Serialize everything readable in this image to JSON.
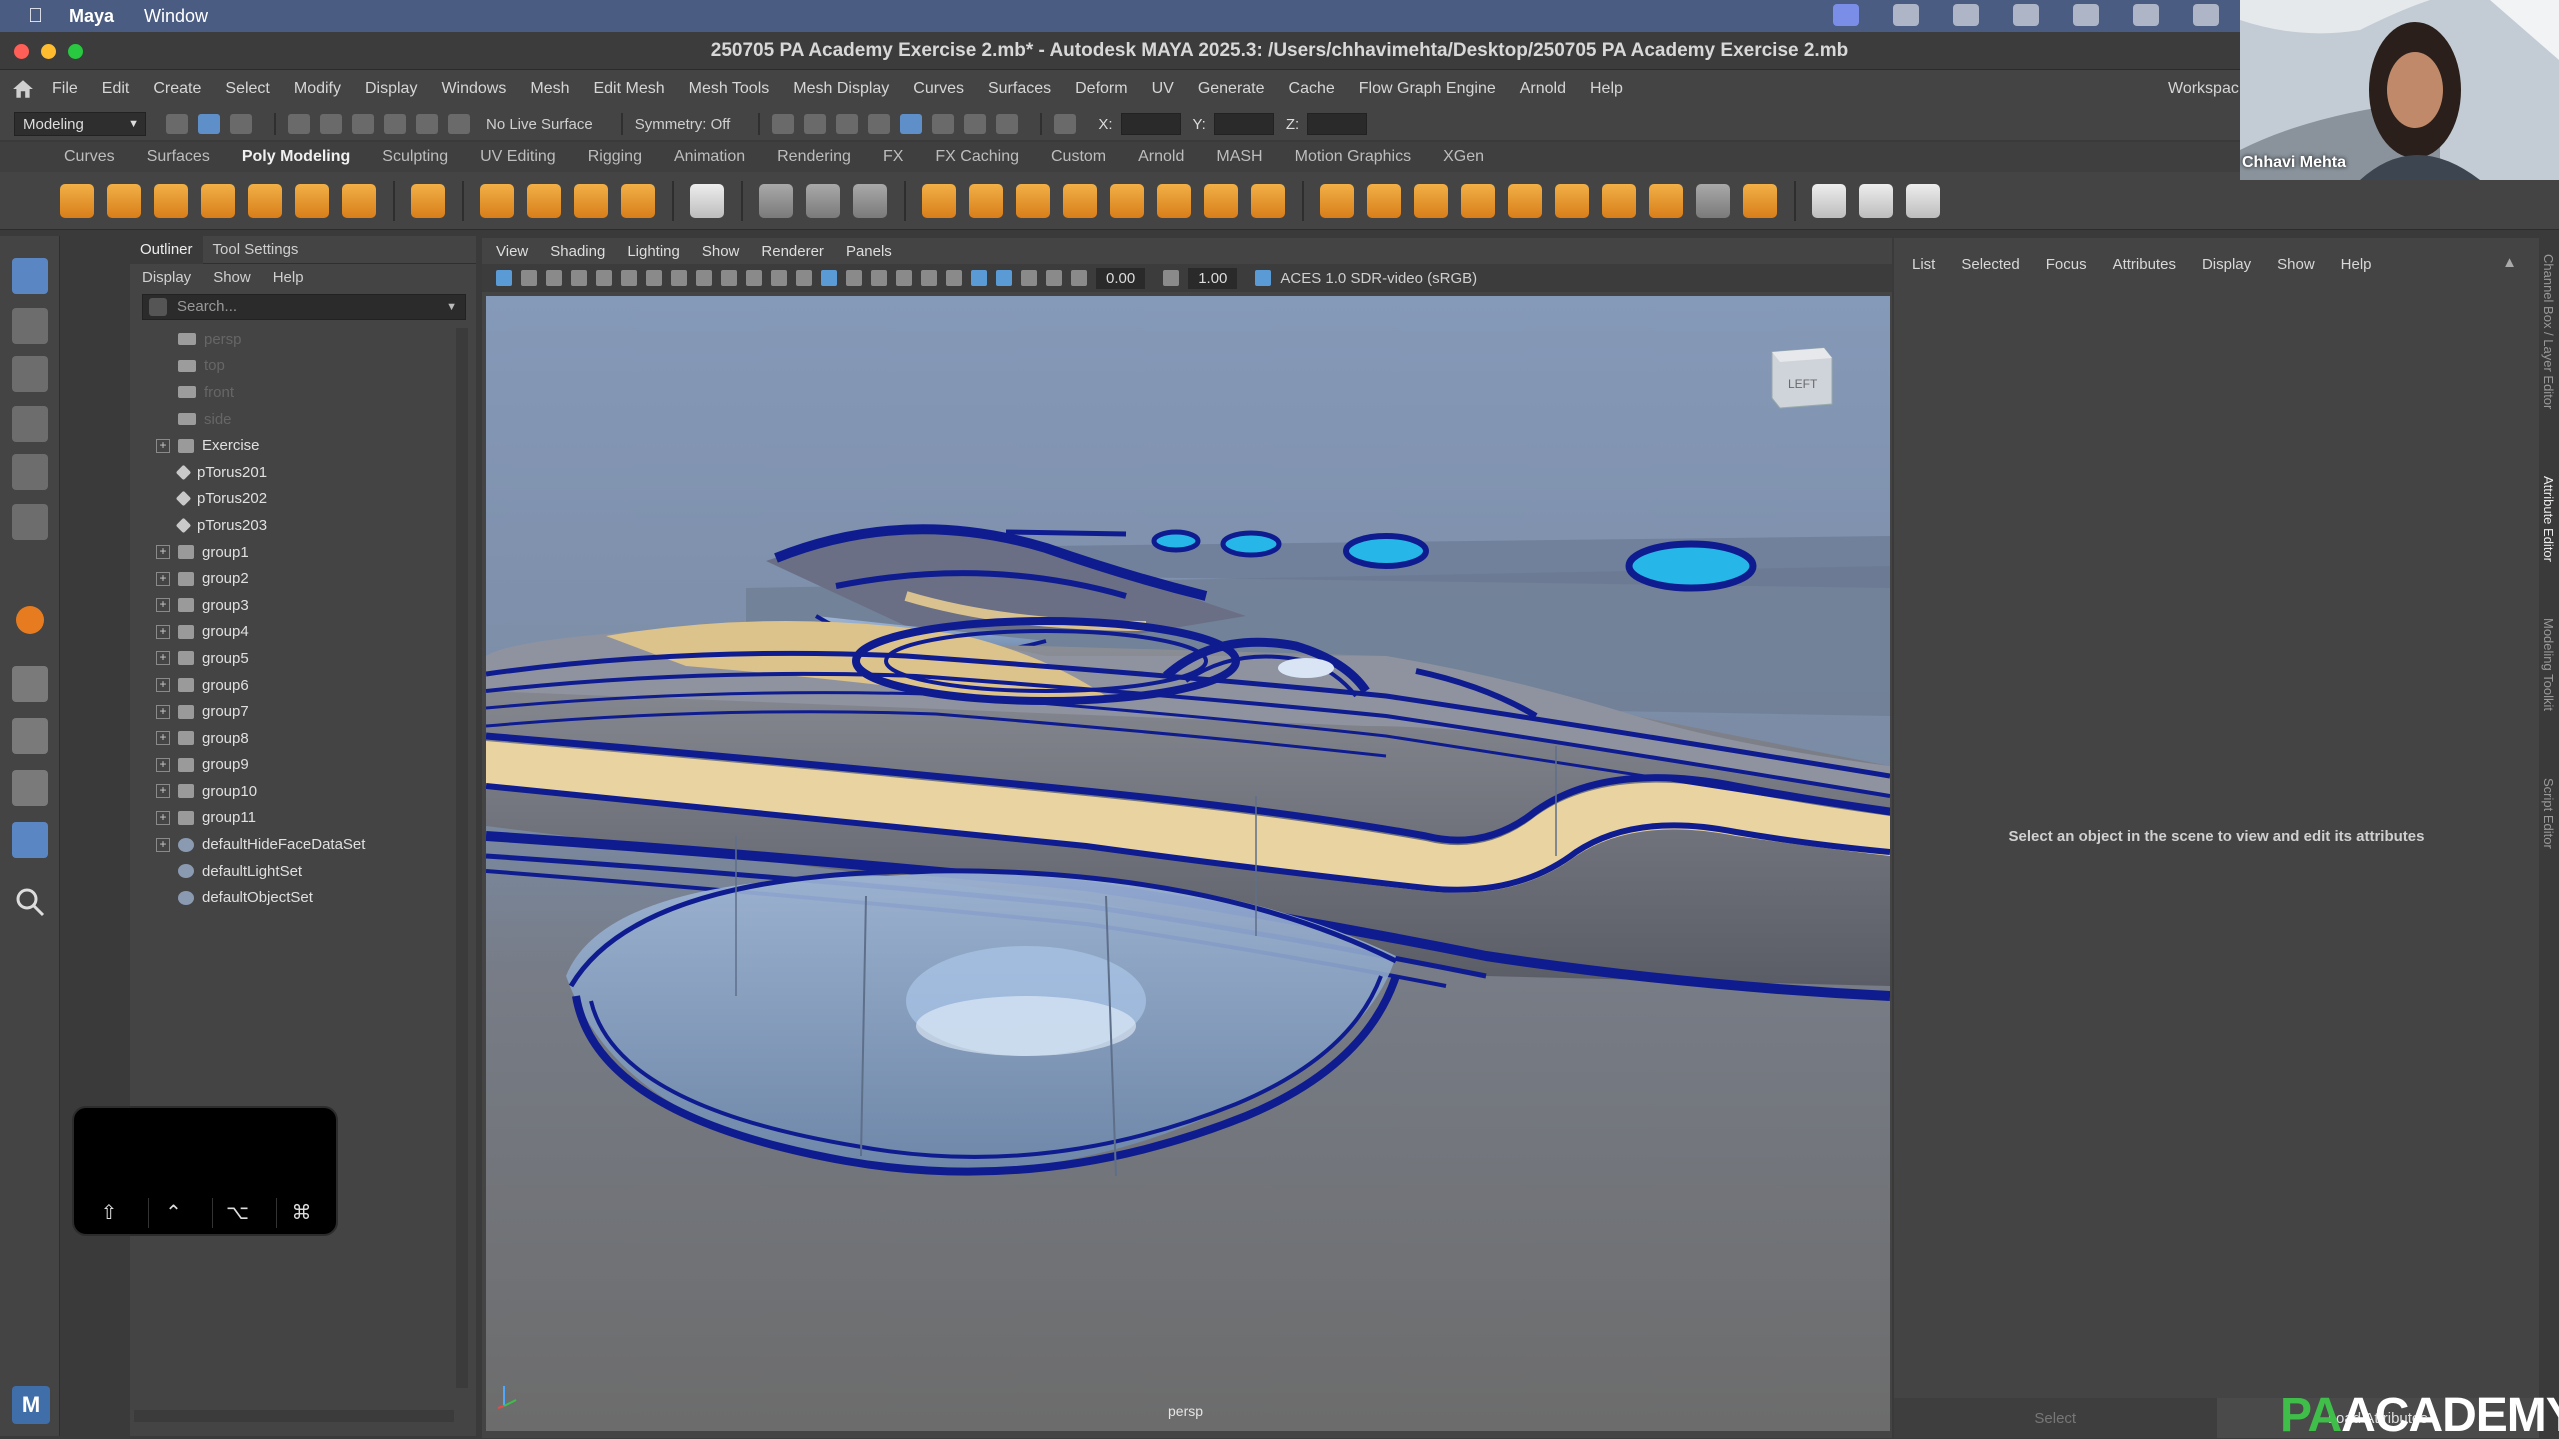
{
  "mac_menubar": {
    "app": "Maya",
    "items": [
      "Window"
    ]
  },
  "window_title": "250705 PA Academy Exercise 2.mb* - Autodesk MAYA 2025.3: /Users/chhavimehta/Desktop/250705 PA Academy Exercise 2.mb",
  "main_menu": [
    "File",
    "Edit",
    "Create",
    "Select",
    "Modify",
    "Display",
    "Windows",
    "Mesh",
    "Edit Mesh",
    "Mesh Tools",
    "Mesh Display",
    "Curves",
    "Surfaces",
    "Deform",
    "UV",
    "Generate",
    "Cache",
    "Flow Graph Engine",
    "Arnold",
    "Help"
  ],
  "workspace_label": "Workspac",
  "status_line": {
    "menu_set": "Modeling",
    "live_surface": "No Live Surface",
    "symmetry": "Symmetry: Off",
    "x_label": "X:",
    "y_label": "Y:",
    "z_label": "Z:"
  },
  "shelf_tabs": [
    "Curves",
    "Surfaces",
    "Poly Modeling",
    "Sculpting",
    "UV Editing",
    "Rigging",
    "Animation",
    "Rendering",
    "FX",
    "FX Caching",
    "Custom",
    "Arnold",
    "MASH",
    "Motion Graphics",
    "XGen"
  ],
  "shelf_active": "Poly Modeling",
  "outliner": {
    "tabs": [
      "Outliner",
      "Tool Settings"
    ],
    "menu": [
      "Display",
      "Show",
      "Help"
    ],
    "search_placeholder": "Search...",
    "items": [
      {
        "label": "persp",
        "kind": "camera",
        "dim": true,
        "expandable": false
      },
      {
        "label": "top",
        "kind": "camera",
        "dim": true,
        "expandable": false
      },
      {
        "label": "front",
        "kind": "camera",
        "dim": true,
        "expandable": false
      },
      {
        "label": "side",
        "kind": "camera",
        "dim": true,
        "expandable": false
      },
      {
        "label": "Exercise",
        "kind": "group",
        "dim": false,
        "expandable": true
      },
      {
        "label": "pTorus201",
        "kind": "transform",
        "dim": false,
        "expandable": false
      },
      {
        "label": "pTorus202",
        "kind": "transform",
        "dim": false,
        "expandable": false
      },
      {
        "label": "pTorus203",
        "kind": "transform",
        "dim": false,
        "expandable": false
      },
      {
        "label": "group1",
        "kind": "group",
        "dim": false,
        "expandable": true
      },
      {
        "label": "group2",
        "kind": "group",
        "dim": false,
        "expandable": true
      },
      {
        "label": "group3",
        "kind": "group",
        "dim": false,
        "expandable": true
      },
      {
        "label": "group4",
        "kind": "group",
        "dim": false,
        "expandable": true
      },
      {
        "label": "group5",
        "kind": "group",
        "dim": false,
        "expandable": true
      },
      {
        "label": "group6",
        "kind": "group",
        "dim": false,
        "expandable": true
      },
      {
        "label": "group7",
        "kind": "group",
        "dim": false,
        "expandable": true
      },
      {
        "label": "group8",
        "kind": "group",
        "dim": false,
        "expandable": true
      },
      {
        "label": "group9",
        "kind": "group",
        "dim": false,
        "expandable": true
      },
      {
        "label": "group10",
        "kind": "group",
        "dim": false,
        "expandable": true
      },
      {
        "label": "group11",
        "kind": "group",
        "dim": false,
        "expandable": true
      },
      {
        "label": "defaultHideFaceDataSet",
        "kind": "set",
        "dim": false,
        "expandable": true
      },
      {
        "label": "defaultLightSet",
        "kind": "set",
        "dim": false,
        "expandable": false
      },
      {
        "label": "defaultObjectSet",
        "kind": "set",
        "dim": false,
        "expandable": false
      }
    ]
  },
  "key_overlay": {
    "keys": [
      "⇧",
      "⌃",
      "⌥",
      "⌘"
    ]
  },
  "viewport": {
    "menu": [
      "View",
      "Shading",
      "Lighting",
      "Show",
      "Renderer",
      "Panels"
    ],
    "exposure": "0.00",
    "gamma": "1.00",
    "color_space": "ACES 1.0 SDR-video (sRGB)",
    "camera_label": "persp",
    "view_cube_label": "LEFT"
  },
  "attribute_editor": {
    "menu": [
      "List",
      "Selected",
      "Focus",
      "Attributes",
      "Display",
      "Show",
      "Help"
    ],
    "message": "Select an object in the scene to view and edit its attributes",
    "select_button": "Select",
    "load_button": "Load Attributes"
  },
  "right_tabs": [
    "Channel Box / Layer Editor",
    "Attribute Editor",
    "Modeling Toolkit",
    "Script Editor"
  ],
  "webcam": {
    "name": "Chhavi Mehta"
  },
  "watermark": {
    "pa": "PA",
    "rest": "ACADEMY"
  },
  "colors": {
    "accent": "#5a86c4",
    "shelf_orange": "#e99a2c",
    "scene_bg_top": "#7f95b5",
    "scene_bg_bottom": "#6f6f6f",
    "curve_navy": "#0f1c8f",
    "glass_cyan": "#26b6e8"
  }
}
